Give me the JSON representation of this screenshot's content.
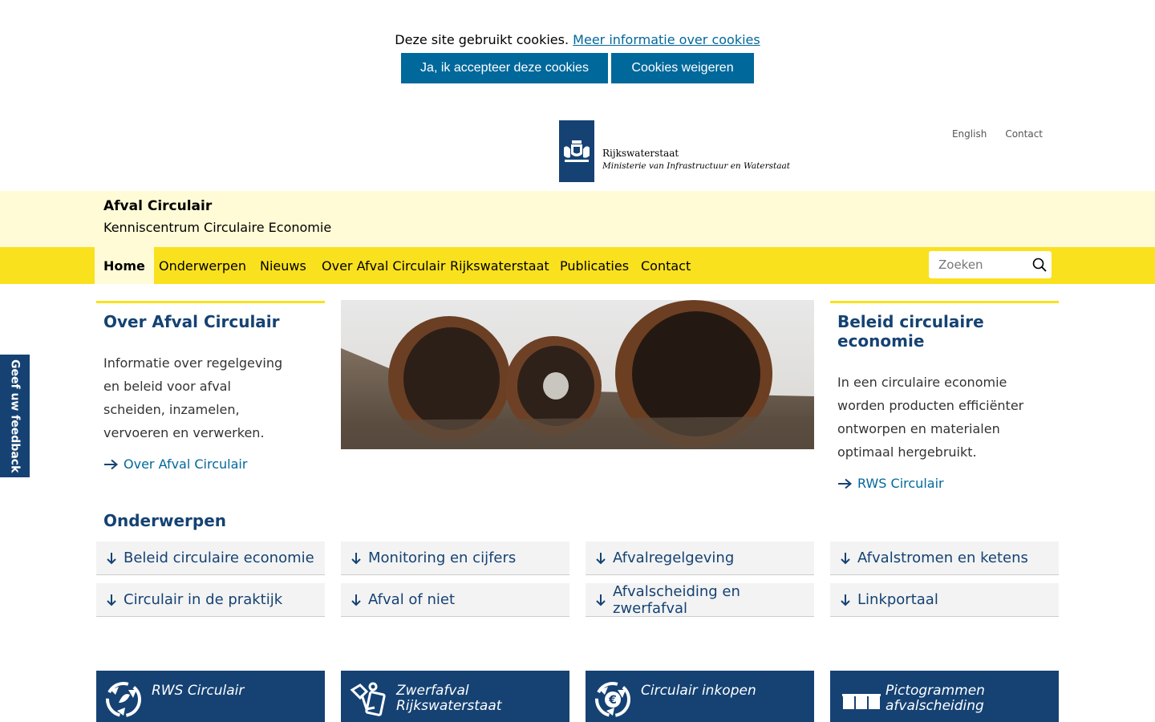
{
  "cookie": {
    "text": "Deze site gebruikt cookies.",
    "link": "Meer informatie over cookies",
    "accept": "Ja, ik accepteer deze cookies",
    "deny": "Cookies weigeren"
  },
  "header": {
    "logo_title": "Rijkswaterstaat",
    "logo_subtitle": "Ministerie van Infrastructuur en Waterstaat",
    "links": [
      "English",
      "Contact"
    ]
  },
  "site": {
    "title": "Afval Circulair",
    "subtitle": "Kenniscentrum Circulaire Economie"
  },
  "nav": {
    "items": [
      "Home",
      "Onderwerpen",
      "Nieuws",
      "Over Afval Circulair",
      "Rijkswaterstaat",
      "Publicaties",
      "Contact"
    ],
    "search_placeholder": "Zoeken"
  },
  "feedback": "Geef uw feedback",
  "left_block": {
    "title": "Over Afval Circulair",
    "text": "Informatie over regelgeving en beleid voor afval scheiden, inzamelen, vervoeren en verwerken.",
    "link": "Over Afval Circulair"
  },
  "right_block": {
    "title": "Beleid circulaire economie",
    "text": "In een circulaire economie worden producten efficiënter ontworpen en materialen optimaal hergebruikt.",
    "link": "RWS Circulair"
  },
  "topics": {
    "title": "Onderwerpen",
    "items": [
      "Beleid circulaire economie",
      "Monitoring en cijfers",
      "Afvalregelgeving",
      "Afvalstromen en ketens",
      "Circulair in de praktijk",
      "Afval of niet",
      "Afvalscheiding en zwerfafval",
      "Linkportaal"
    ]
  },
  "tiles": [
    {
      "label": "RWS Circulair",
      "icon": "recycle-arrows-icon"
    },
    {
      "label": "Zwerfafval Rijkswaterstaat",
      "icon": "litter-icon"
    },
    {
      "label": "Circulair inkopen",
      "icon": "euro-recycle-icon"
    },
    {
      "label": "Pictogrammen afvalscheiding",
      "icon": "bins-icon"
    }
  ],
  "colors": {
    "brand_blue": "#154273",
    "link_blue": "#01689b",
    "yellow": "#f9e11e",
    "light_yellow": "#fffbd6"
  }
}
